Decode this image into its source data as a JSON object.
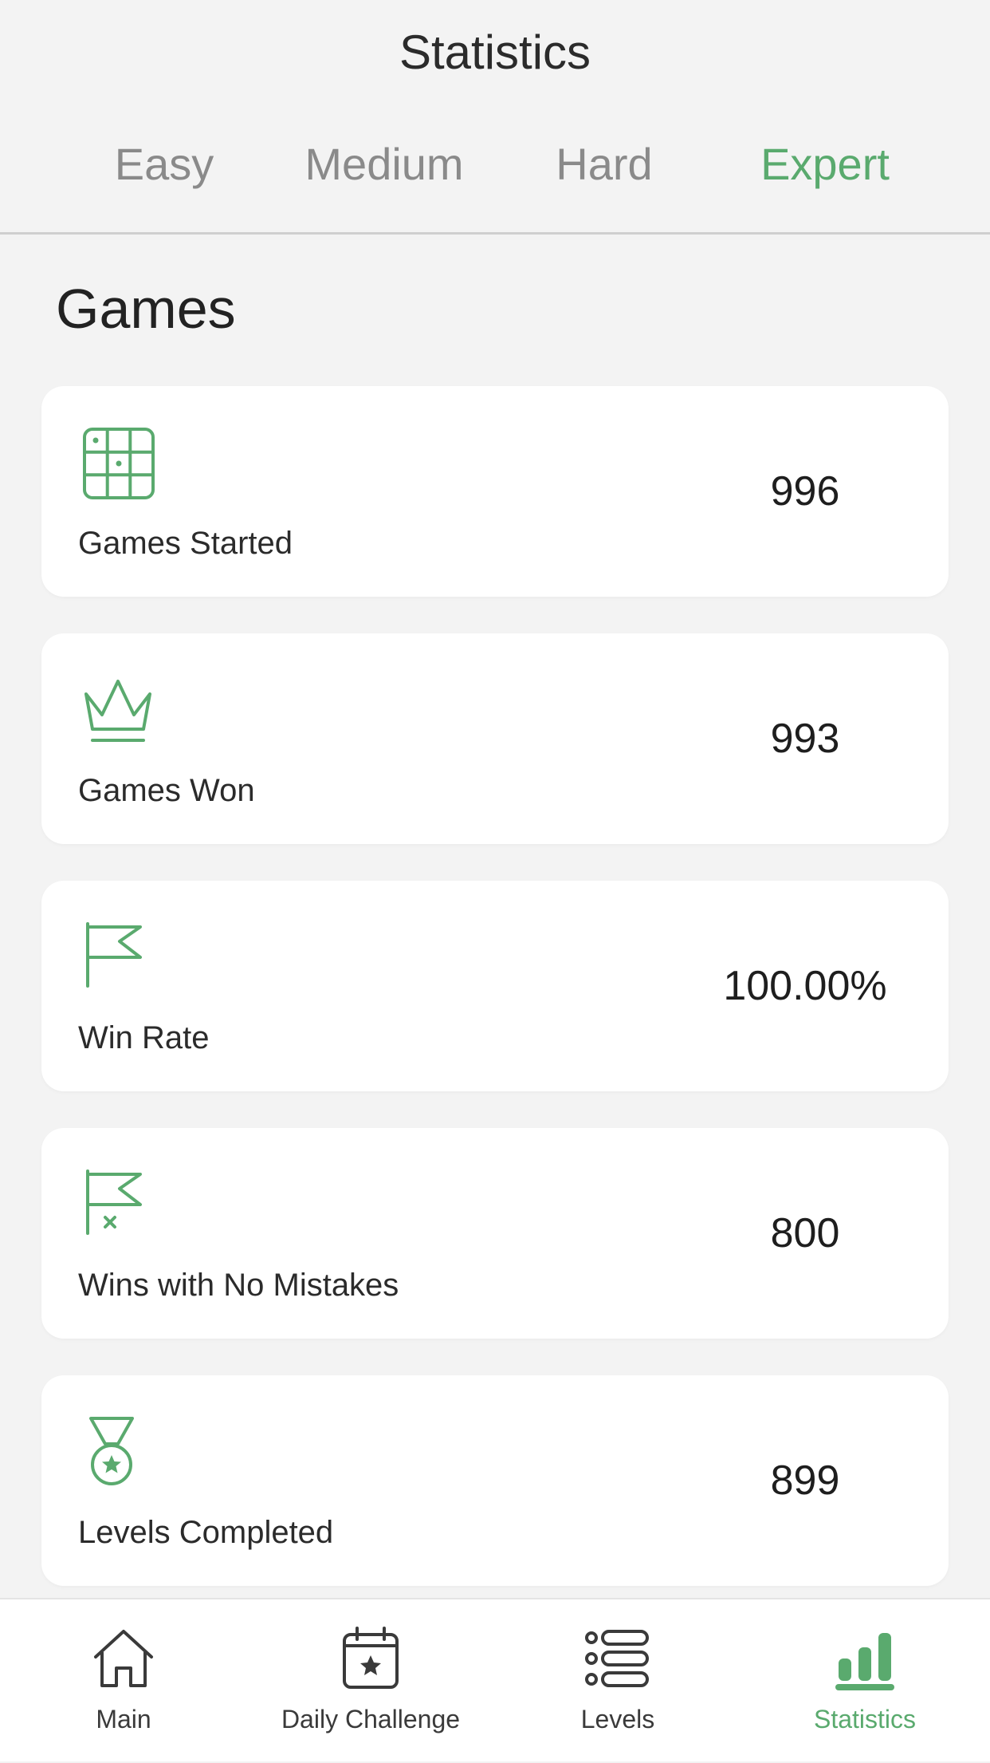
{
  "header": {
    "title": "Statistics"
  },
  "tabs": [
    {
      "label": "Easy",
      "active": false
    },
    {
      "label": "Medium",
      "active": false
    },
    {
      "label": "Hard",
      "active": false
    },
    {
      "label": "Expert",
      "active": true
    }
  ],
  "section": {
    "title": "Games"
  },
  "stats": [
    {
      "icon": "sudoku-grid-icon",
      "label": "Games Started",
      "value": "996"
    },
    {
      "icon": "crown-icon",
      "label": "Games Won",
      "value": "993"
    },
    {
      "icon": "flag-icon",
      "label": "Win Rate",
      "value": "100.00%"
    },
    {
      "icon": "flag-no-mistakes-icon",
      "label": "Wins with No Mistakes",
      "value": "800"
    },
    {
      "icon": "medal-icon",
      "label": "Levels Completed",
      "value": "899"
    }
  ],
  "bottom_nav": [
    {
      "icon": "home-icon",
      "label": "Main",
      "active": false
    },
    {
      "icon": "calendar-star-icon",
      "label": "Daily Challenge",
      "active": false
    },
    {
      "icon": "list-icon",
      "label": "Levels",
      "active": false
    },
    {
      "icon": "bar-chart-icon",
      "label": "Statistics",
      "active": true
    }
  ],
  "colors": {
    "accent": "#5aaa6e",
    "background": "#f3f3f3",
    "card": "#ffffff",
    "inactive_tab": "#8a8a8a"
  }
}
